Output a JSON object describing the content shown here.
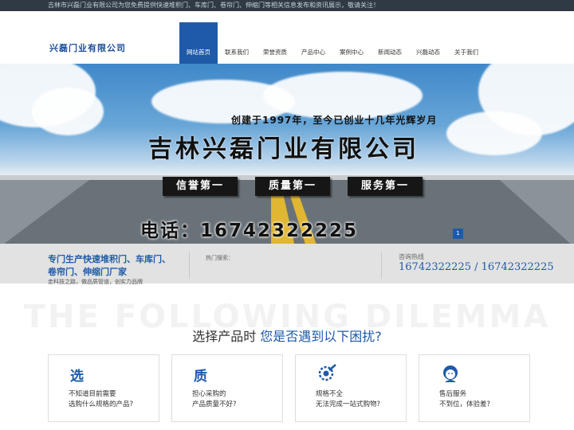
{
  "topbar": {
    "text": "吉林市兴磊门业有限公司为您免费提供快速堆积门、车库门、卷帘门、伸缩门等相关信息发布和资讯展示，敬请关注！"
  },
  "header": {
    "logo": "兴磊门业有限公司"
  },
  "nav": {
    "items": [
      "网站首页",
      "联系我们",
      "荣誉资质",
      "产品中心",
      "案例中心",
      "新闻动态",
      "兴磊动态",
      "关于我们"
    ]
  },
  "banner": {
    "subtitle": "创建于1997年，至今已创业十几年光辉岁月",
    "title": "吉林兴磊门业有限公司",
    "tags": [
      "信誉第一",
      "质量第一",
      "服务第一"
    ],
    "phone": "电话：16742322225",
    "slide_number": "1"
  },
  "infobar": {
    "main_line1": "专门生产快速堆积门、车库门、",
    "main_line2": "卷帘门、伸缩门厂家",
    "slogan": "走科技之路，做品质管道，创实力品牌",
    "search_label": "热门搜索：",
    "hotline_label": "咨询热线",
    "hotline": "16742322225 / 16742322225"
  },
  "section": {
    "bg_text": "THE FOLLOWING DILEMMA",
    "title_part1": "选择产品时 ",
    "title_part2": "您是否遇到以下困扰?"
  },
  "cards": [
    {
      "head": "选",
      "icon": "",
      "line1": "不知道目前需要",
      "line2": "选购什么规格的产品?"
    },
    {
      "head": "质",
      "icon": "",
      "line1": "担心采购的",
      "line2": "产品质量不好?"
    },
    {
      "head": "",
      "icon": "gear-wrench-icon",
      "line1": "规格不全",
      "line2": "无法完成一站式购物?"
    },
    {
      "head": "",
      "icon": "customer-service-icon",
      "line1": "售后服务",
      "line2": "不到位，体验差?"
    }
  ],
  "colors": {
    "brand": "#1e5aa8",
    "topbar": "#2f3a45",
    "infobar": "#e2e2e2"
  }
}
